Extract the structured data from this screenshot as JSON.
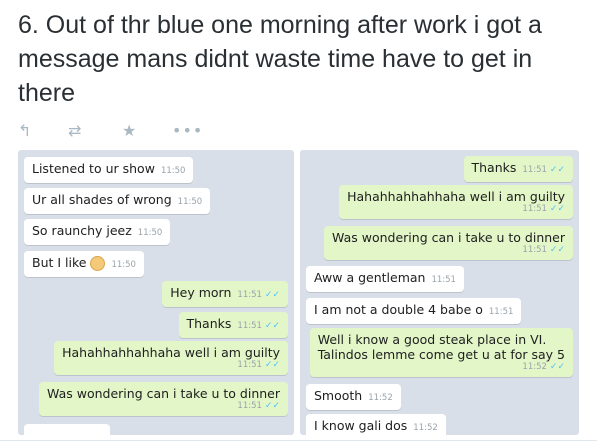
{
  "tweet": {
    "text": "6. Out of thr blue one morning after work i got a message mans didnt waste time have to get in there"
  },
  "actions": {
    "reply_icon": "reply-icon",
    "retweet_icon": "retweet-icon",
    "like_icon": "star-icon",
    "more_icon": "more-icon"
  },
  "colors": {
    "chat_background": "#d8dfe9",
    "incoming_bubble": "#ffffff",
    "outgoing_bubble": "#e3f6c8",
    "read_ticks": "#4fc3f7"
  },
  "left_chat": {
    "messages": [
      {
        "text": "Listened to ur show",
        "time": "11:50",
        "dir": "in"
      },
      {
        "text": "Ur all shades of wrong",
        "time": "11:50",
        "dir": "in"
      },
      {
        "text": "So raunchy jeez",
        "time": "11:50",
        "dir": "in"
      },
      {
        "text": "But I like",
        "time": "11:50",
        "dir": "in"
      },
      {
        "text": "Hey morn",
        "time": "11:51",
        "dir": "out"
      },
      {
        "text": "Thanks",
        "time": "11:51",
        "dir": "out"
      },
      {
        "text": "Hahahhahhahhaha well i am guilty",
        "time": "11:51",
        "dir": "out"
      },
      {
        "text": "Was wondering can i take u to dinner",
        "time": "11:51",
        "dir": "out"
      }
    ]
  },
  "right_chat": {
    "messages": [
      {
        "text": "Thanks",
        "time": "11:51",
        "dir": "out"
      },
      {
        "text": "Hahahhahhahhaha well i am guilty",
        "time": "11:51",
        "dir": "out"
      },
      {
        "text": "Was wondering can i take u to dinner",
        "time": "11:51",
        "dir": "out"
      },
      {
        "text": "Aww a gentleman",
        "time": "11:51",
        "dir": "in"
      },
      {
        "text": "I am not a double 4 babe o",
        "time": "11:51",
        "dir": "in"
      },
      {
        "text": "Well i know a good steak place in VI.",
        "text2": "Talindos lemme come get u at for say 5",
        "time": "11:52",
        "dir": "out"
      },
      {
        "text": "Smooth",
        "time": "11:52",
        "dir": "in"
      },
      {
        "text": "I know gali dos",
        "time": "11:52",
        "dir": "in"
      }
    ]
  }
}
